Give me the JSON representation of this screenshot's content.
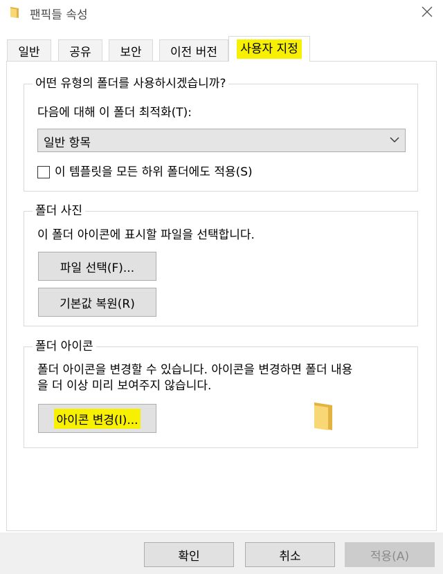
{
  "window": {
    "title": "팬픽들 속성",
    "close_icon": "close-icon"
  },
  "tabs": [
    {
      "label": "일반",
      "active": false
    },
    {
      "label": "공유",
      "active": false
    },
    {
      "label": "보안",
      "active": false
    },
    {
      "label": "이전 버전",
      "active": false
    },
    {
      "label": "사용자 지정",
      "active": true
    }
  ],
  "folder_type": {
    "group_title": "어떤 유형의 폴더를 사용하시겠습니까?",
    "optimize_label": "다음에 대해 이 폴더 최적화(T):",
    "selected": "일반 항목",
    "apply_template_label": "이 템플릿을 모든 하위 폴더에도 적용(S)",
    "apply_template_checked": false
  },
  "folder_pictures": {
    "group_title": "폴더 사진",
    "description": "이 폴더 아이콘에 표시할 파일을 선택합니다.",
    "choose_file_label": "파일 선택(F)...",
    "restore_default_label": "기본값 복원(R)"
  },
  "folder_icons": {
    "group_title": "폴더 아이콘",
    "description_line1": "폴더 아이콘을 변경할 수 있습니다. 아이콘을 변경하면 폴더 내용",
    "description_line2": "을 더 이상  미리 보여주지 않습니다.",
    "change_icon_label": "아이콘 변경(I)..."
  },
  "footer": {
    "ok_label": "확인",
    "cancel_label": "취소",
    "apply_label": "적용(A)"
  },
  "colors": {
    "highlight": "#f7f000",
    "folder_yellow": "#f8d775",
    "folder_dark": "#e3b341",
    "border": "#d9d9d9"
  }
}
